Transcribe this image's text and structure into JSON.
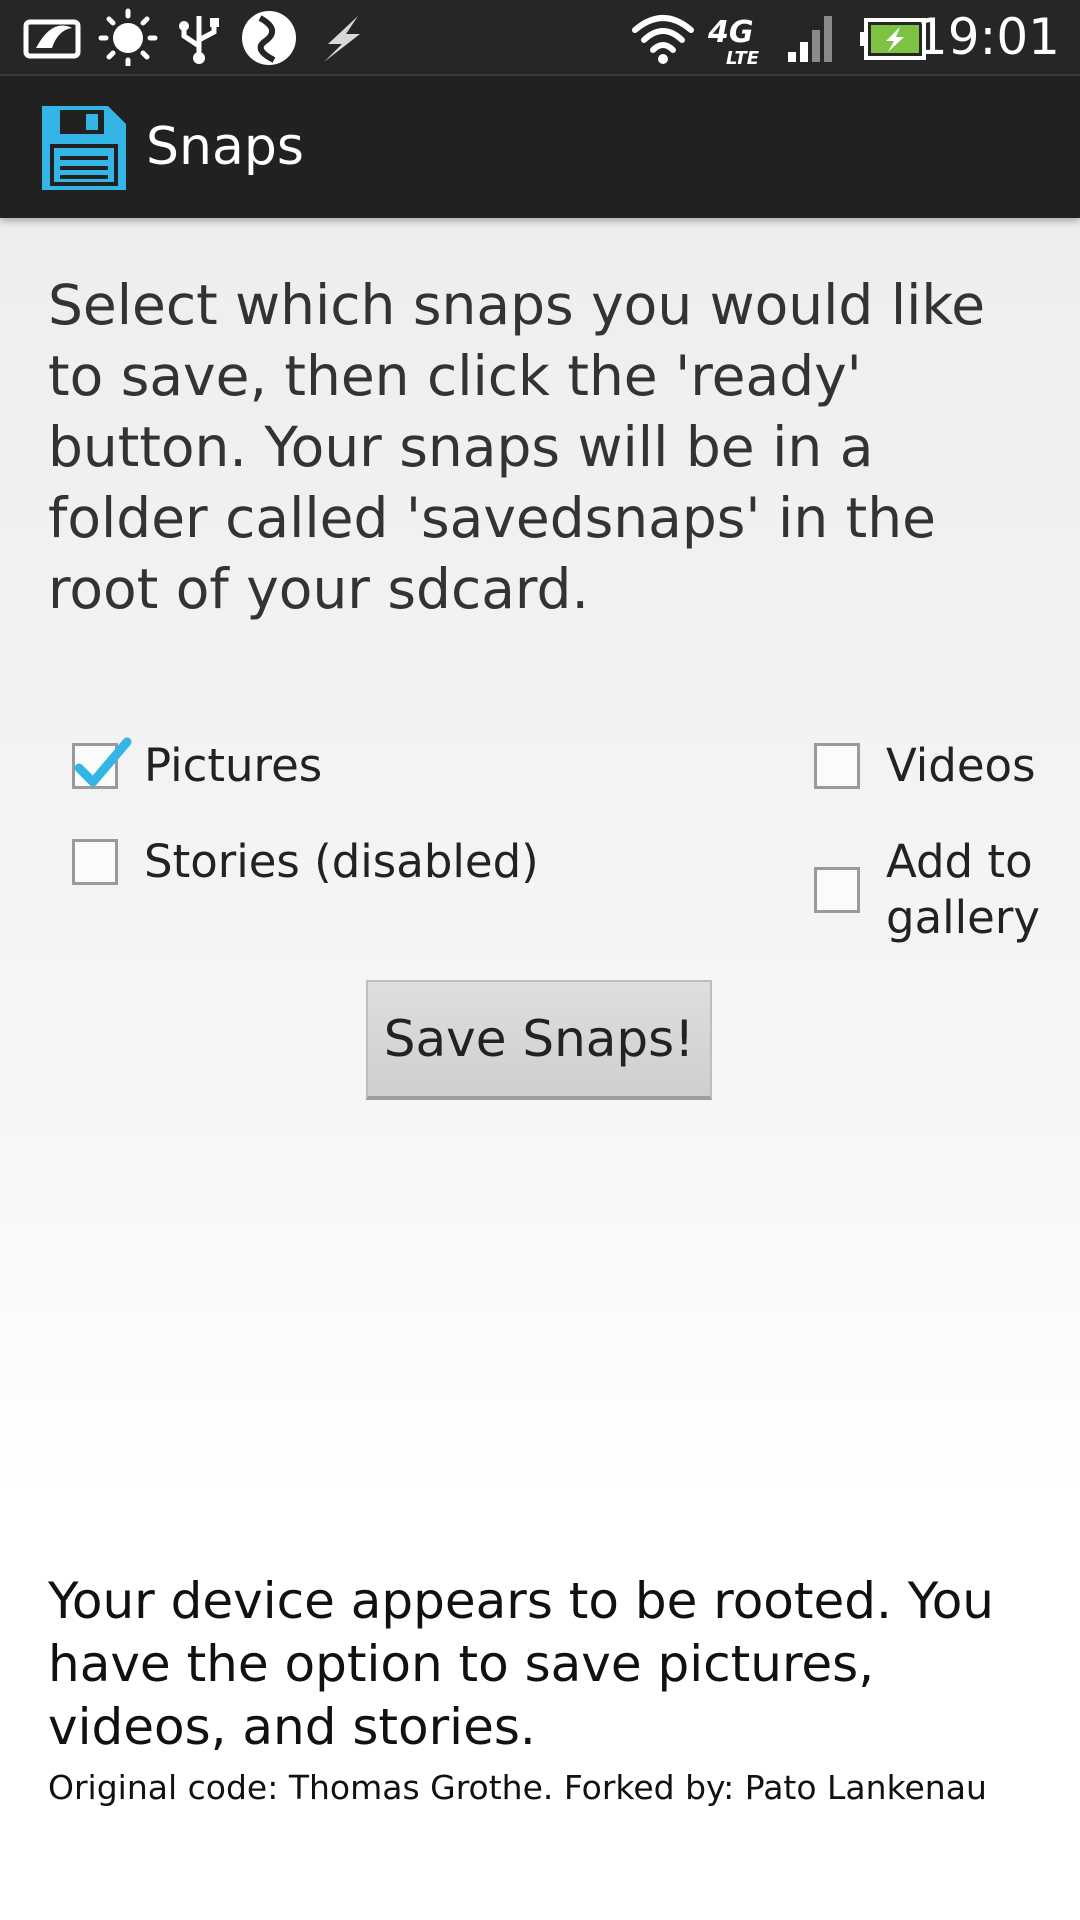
{
  "status_bar": {
    "time": "19:01",
    "left_icons": [
      "screen-saver-icon",
      "brightness-icon",
      "usb-icon",
      "swiftkey-icon",
      "flash-icon"
    ],
    "right_icons": [
      "wifi-icon",
      "lte-4g-icon",
      "signal-icon",
      "battery-charging-icon"
    ],
    "battery_color": "#7dc242"
  },
  "action_bar": {
    "title": "Snaps",
    "icon": "floppy-disk-icon",
    "icon_color": "#33b5e5"
  },
  "content": {
    "intro": "Select which snaps you would like to save, then click the 'ready' button. Your snaps will be in a folder called 'savedsnaps' in the root of your sdcard.",
    "options": {
      "pictures": {
        "label": "Pictures",
        "checked": true
      },
      "videos": {
        "label": "Videos",
        "checked": false
      },
      "stories": {
        "label": "Stories (disabled)",
        "checked": false
      },
      "gallery": {
        "label_line1": "Add to",
        "label_line2": "gallery",
        "checked": false
      }
    },
    "save_button_label": "Save Snaps!",
    "rooted_message": "Your device appears to be rooted. You have the option to save pictures, videos, and stories.",
    "credits": "Original code: Thomas Grothe. Forked by: Pato Lankenau"
  }
}
